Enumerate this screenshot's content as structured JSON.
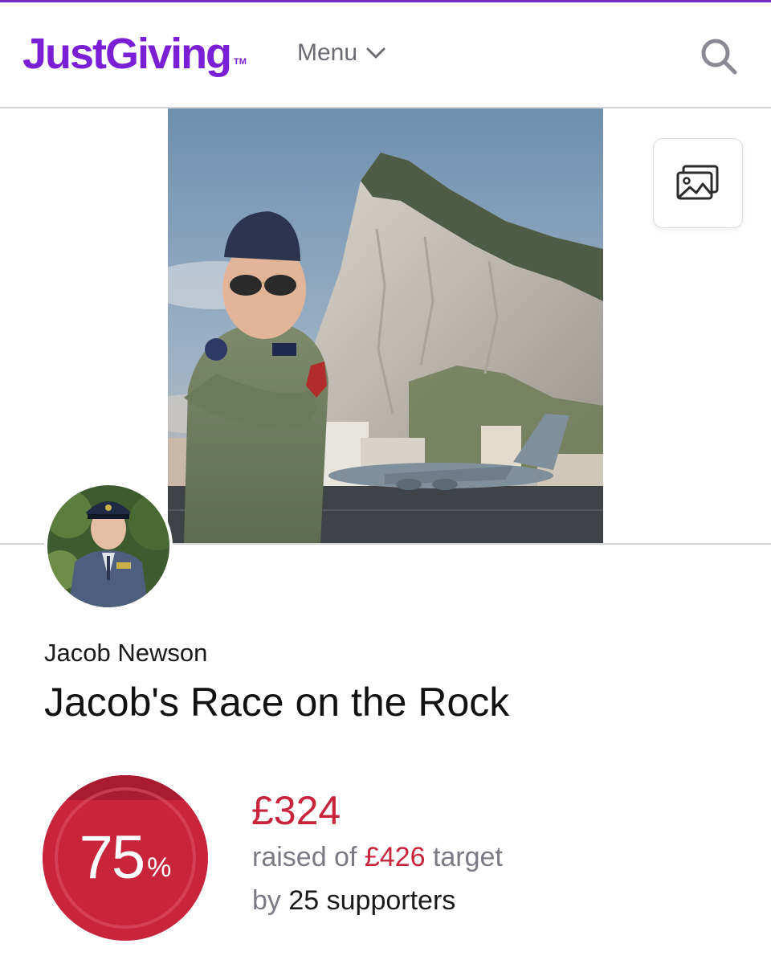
{
  "header": {
    "logo_text": "JustGiving",
    "logo_tm": "TM",
    "menu_label": "Menu",
    "search_icon": "search-icon",
    "accent_color": "#7a1fd6"
  },
  "hero": {
    "image_desc": "boy-in-flight-suit-with-gibraltar-rock-and-aircraft",
    "gallery_icon": "image-gallery-icon"
  },
  "profile": {
    "avatar_icon": "avatar",
    "fundraiser_name": "Jacob Newson",
    "page_title": "Jacob's Race on the Rock"
  },
  "progress": {
    "percent": "75",
    "percent_sign": "%",
    "percent_value": 75,
    "raised": "£324",
    "raised_prefix": "raised of",
    "target": "£426",
    "target_suffix": "target",
    "by_label": "by",
    "supporters": "25 supporters",
    "color": "#c8243c"
  }
}
